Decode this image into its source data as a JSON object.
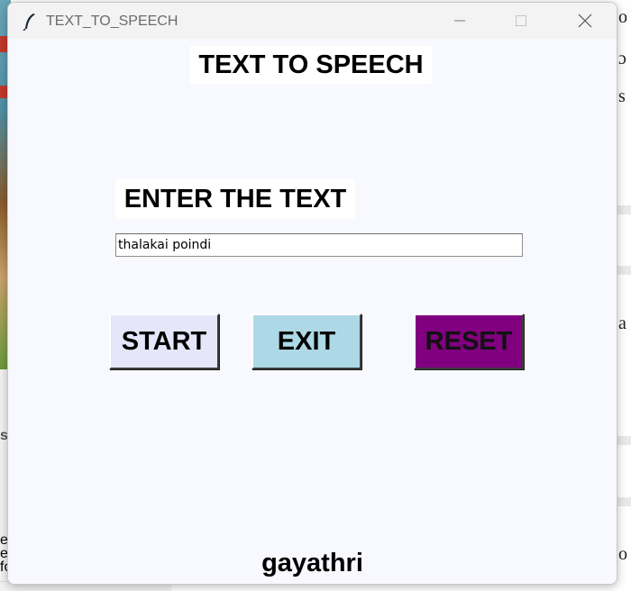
{
  "window": {
    "title": "TEXT_TO_SPEECH"
  },
  "app": {
    "heading": "TEXT TO SPEECH",
    "input_label": "ENTER THE TEXT",
    "input_value": "thalakai poindi",
    "buttons": {
      "start": "START",
      "exit": "EXIT",
      "reset": "RESET"
    },
    "footer": "gayathri"
  },
  "colors": {
    "window_bg": "#f8f8ff",
    "start_bg": "#e6e6fa",
    "exit_bg": "#add8e6",
    "reset_bg": "#800080"
  },
  "icons": {
    "app": "feather-icon",
    "minimize": "minimize-icon",
    "maximize": "maximize-icon",
    "close": "close-icon"
  }
}
